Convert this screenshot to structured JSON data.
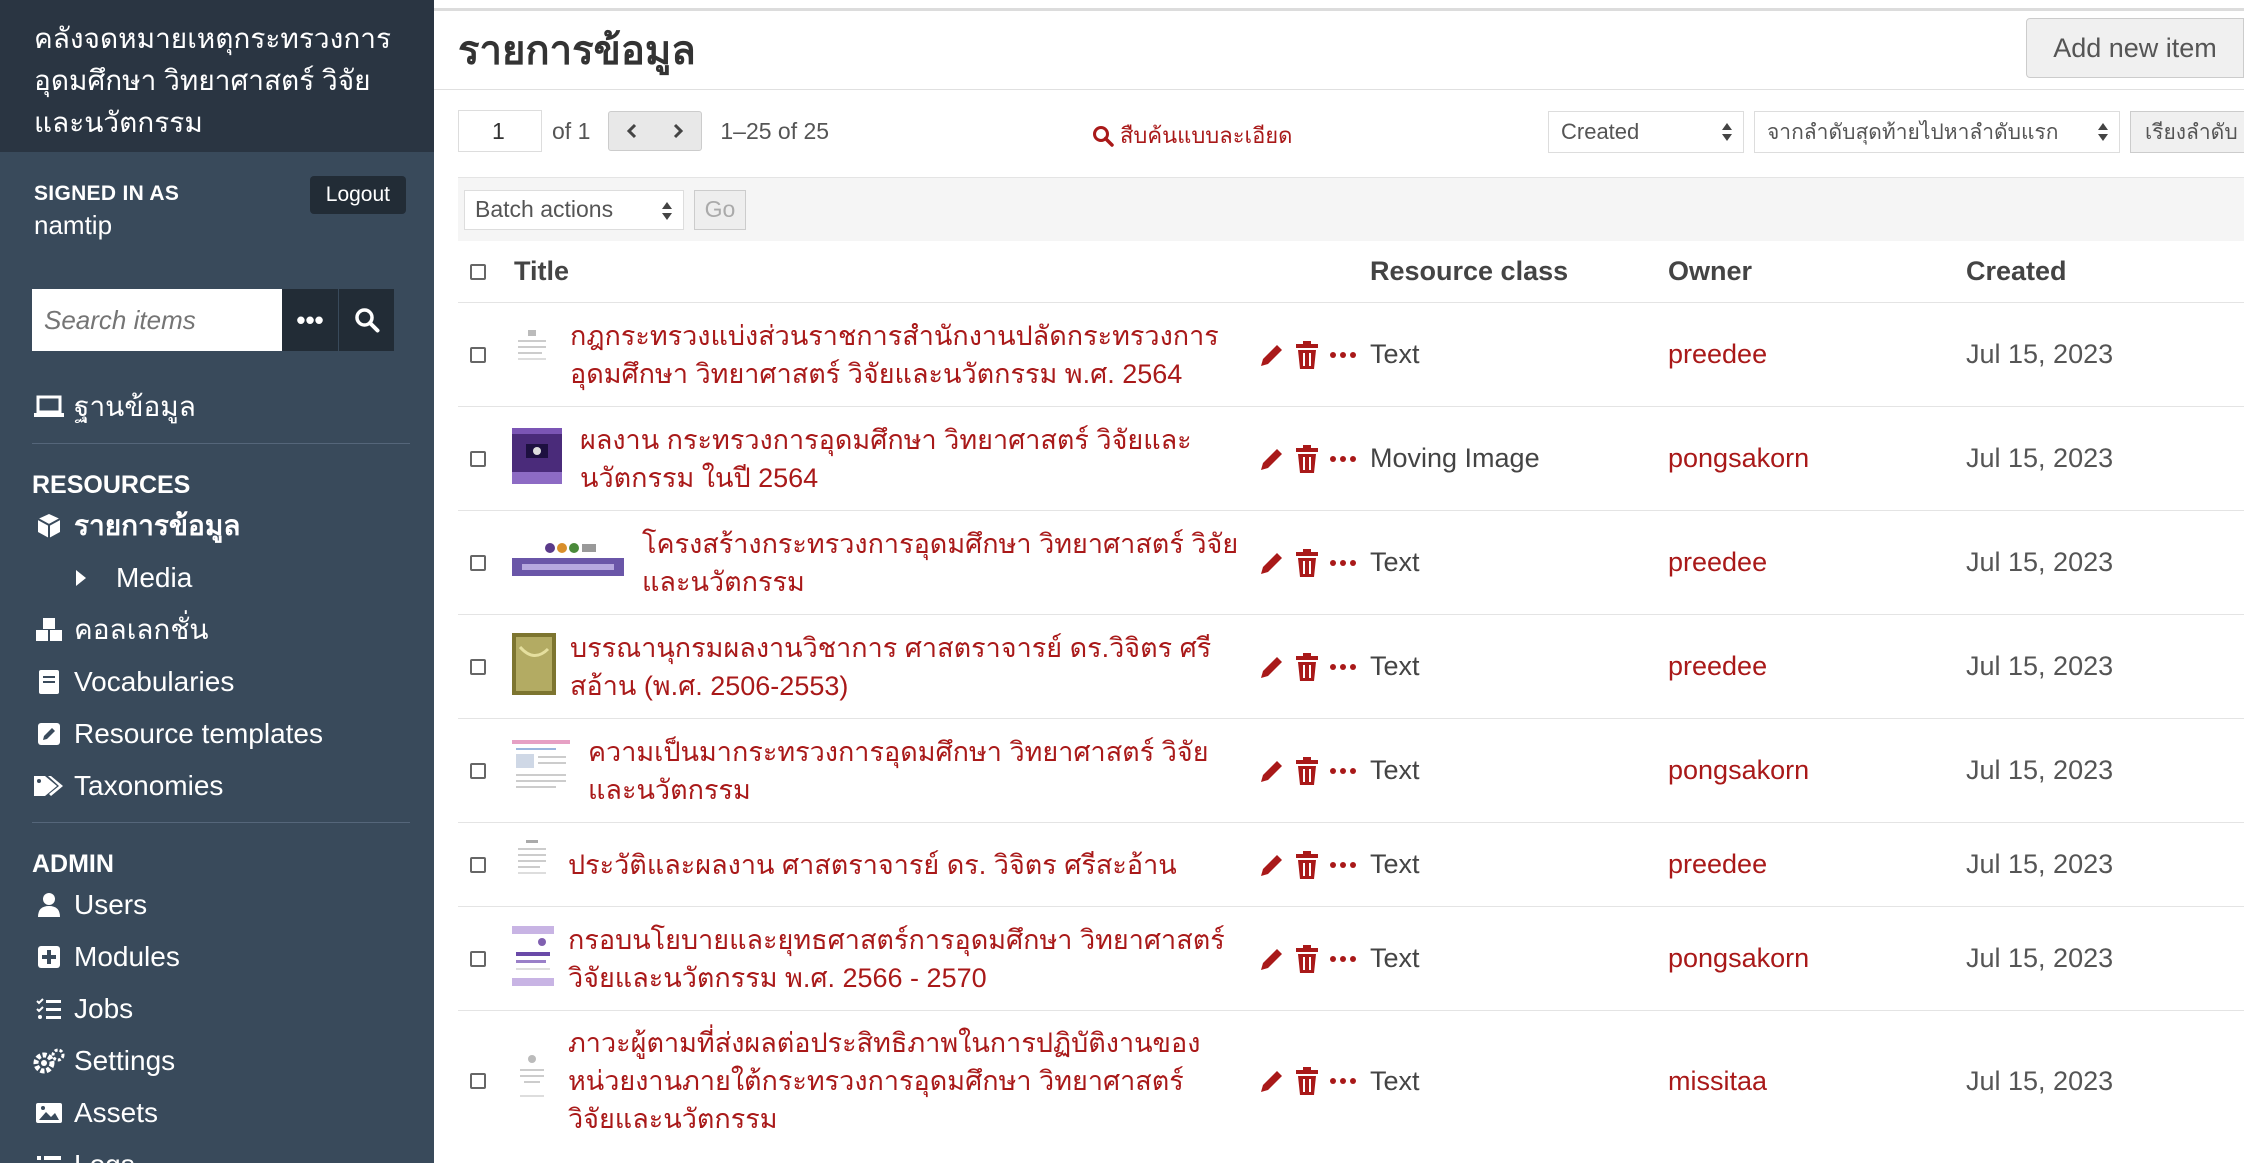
{
  "sidebar": {
    "site_title": "คลังจดหมายเหตุกระทรวงการอุดมศึกษา วิทยาศาสตร์ วิจัยและนวัตกรรม",
    "signed_in_label": "SIGNED IN AS",
    "username": "namtip",
    "logout_label": "Logout",
    "search_placeholder": "Search items",
    "search_options": "•••",
    "nav_top": {
      "label": "ฐานข้อมูล",
      "icon": "laptop-icon"
    },
    "resources_heading": "RESOURCES",
    "resources": [
      {
        "label": "รายการข้อมูล",
        "icon": "cube-icon",
        "active": true
      },
      {
        "label": "Media",
        "icon": "caret-right-icon",
        "sub": true
      },
      {
        "label": "คอลเลกชั่น",
        "icon": "cubes-icon"
      },
      {
        "label": "Vocabularies",
        "icon": "book-icon"
      },
      {
        "label": "Resource templates",
        "icon": "edit-square-icon"
      },
      {
        "label": "Taxonomies",
        "icon": "tags-icon"
      }
    ],
    "admin_heading": "ADMIN",
    "admin": [
      {
        "label": "Users",
        "icon": "user-icon"
      },
      {
        "label": "Modules",
        "icon": "plus-square-icon"
      },
      {
        "label": "Jobs",
        "icon": "tasks-icon"
      },
      {
        "label": "Settings",
        "icon": "cogs-icon"
      },
      {
        "label": "Assets",
        "icon": "image-icon"
      },
      {
        "label": "Logs",
        "icon": "list-icon"
      }
    ]
  },
  "header": {
    "title": "รายการข้อมูล",
    "add_button": "Add new item"
  },
  "toolbar": {
    "page_value": "1",
    "page_of": "of 1",
    "range": "1–25 of 25",
    "advanced_search": "สืบค้นแบบละเอียด",
    "sort_by": "Created",
    "sort_order": "จากลำดับสุดท้ายไปหาลำดับแรก",
    "sort_button": "เรียงลำดับ",
    "batch_actions": "Batch actions",
    "go_label": "Go"
  },
  "table": {
    "headers": {
      "title": "Title",
      "resource_class": "Resource class",
      "owner": "Owner",
      "created": "Created"
    },
    "rows": [
      {
        "title_1": "กฎกระทรวงแบ่งส่วนราชการสำนักงานปลัดกระทรวงการ",
        "title_2": "อุดมศึกษา วิทยาศาสตร์ วิจัยและนวัตกรรม พ.ศ. 2564",
        "resource_class": "Text",
        "owner": "preedee",
        "created": "Jul 15, 2023"
      },
      {
        "title_1": "ผลงาน กระทรวงการอุดมศึกษา วิทยาศาสตร์ วิจัยและ",
        "title_2": "นวัตกรรม ในปี 2564",
        "resource_class": "Moving Image",
        "owner": "pongsakorn",
        "created": "Jul 15, 2023"
      },
      {
        "title_1": "โครงสร้างกระทรวงการอุดมศึกษา วิทยาศาสตร์ วิจัย",
        "title_2": "และนวัตกรรม",
        "resource_class": "Text",
        "owner": "preedee",
        "created": "Jul 15, 2023"
      },
      {
        "title_1": "บรรณานุกรมผลงานวิชาการ ศาสตราจารย์ ดร.วิจิตร ศรี",
        "title_2": "สอ้าน (พ.ศ. 2506-2553)",
        "resource_class": "Text",
        "owner": "preedee",
        "created": "Jul 15, 2023"
      },
      {
        "title_1": "ความเป็นมากระทรวงการอุดมศึกษา วิทยาศาสตร์ วิจัย",
        "title_2": "และนวัตกรรม",
        "resource_class": "Text",
        "owner": "pongsakorn",
        "created": "Jul 15, 2023"
      },
      {
        "title_1": "ประวัติและผลงาน ศาสตราจารย์ ดร. วิจิตร ศรีสะอ้าน",
        "title_2": "",
        "resource_class": "Text",
        "owner": "preedee",
        "created": "Jul 15, 2023"
      },
      {
        "title_1": "กรอบนโยบายและยุทธศาสตร์การอุดมศึกษา วิทยาศาสตร์",
        "title_2": "วิจัยและนวัตกรรม พ.ศ. 2566 - 2570",
        "resource_class": "Text",
        "owner": "pongsakorn",
        "created": "Jul 15, 2023"
      },
      {
        "title_1": "ภาวะผู้ตามที่ส่งผลต่อประสิทธิภาพในการปฏิบัติงานของ",
        "title_2": "หน่วยงานภายใต้กระทรวงการอุดมศึกษา วิทยาศาสตร์",
        "title_3": "วิจัยและนวัตกรรม",
        "resource_class": "Text",
        "owner": "missitaa",
        "created": "Jul 15, 2023"
      }
    ]
  },
  "colors": {
    "link": "#a91919",
    "sidebar": "#394a5b",
    "sidebar_dark": "#2a3542"
  }
}
